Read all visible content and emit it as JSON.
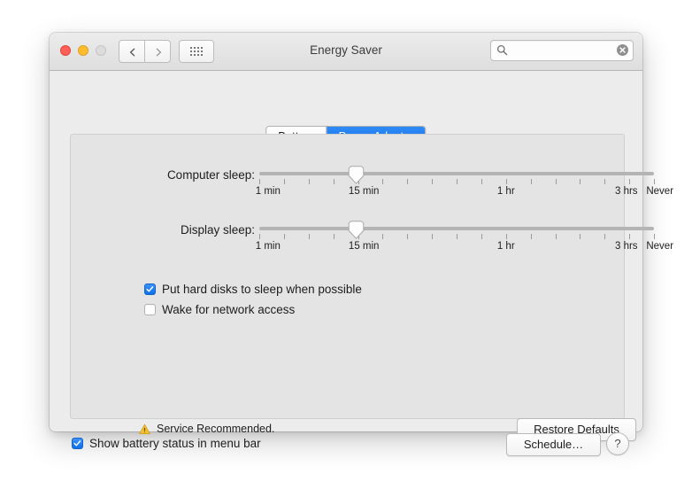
{
  "window": {
    "title": "Energy Saver",
    "traffic_lights": [
      "close",
      "minimize",
      "zoom"
    ],
    "nav": {
      "back": "back-arrow",
      "forward": "forward-arrow",
      "grid": "show-all-grid"
    },
    "search": {
      "value": "",
      "placeholder": "",
      "icon": "search-icon",
      "clear_icon": "clear-icon"
    }
  },
  "tabs": {
    "items": [
      {
        "label": "Battery",
        "active": false
      },
      {
        "label": "Power Adapter",
        "active": true
      }
    ],
    "accent_color": "#0e6fe8"
  },
  "sliders": [
    {
      "name": "computer-sleep",
      "label": "Computer sleep:",
      "value_percent": 24.5,
      "tick_count": 17,
      "scale": [
        {
          "text": "1 min",
          "pos_percent": 2.2
        },
        {
          "text": "15 min",
          "pos_percent": 26.5
        },
        {
          "text": "1 hr",
          "pos_percent": 62.5
        },
        {
          "text": "3 hrs",
          "pos_percent": 93.0
        },
        {
          "text": "Never",
          "pos_percent": 101.5
        }
      ]
    },
    {
      "name": "display-sleep",
      "label": "Display sleep:",
      "value_percent": 24.5,
      "tick_count": 17,
      "scale": [
        {
          "text": "1 min",
          "pos_percent": 2.2
        },
        {
          "text": "15 min",
          "pos_percent": 26.5
        },
        {
          "text": "1 hr",
          "pos_percent": 62.5
        },
        {
          "text": "3 hrs",
          "pos_percent": 93.0
        },
        {
          "text": "Never",
          "pos_percent": 101.5
        }
      ]
    }
  ],
  "checkboxes": {
    "hard_disks": {
      "label": "Put hard disks to sleep when possible",
      "checked": true
    },
    "wake_network": {
      "label": "Wake for network access",
      "checked": false
    },
    "battery_status": {
      "label": "Show battery status in menu bar",
      "checked": true
    }
  },
  "status": {
    "icon": "warning-triangle-icon",
    "text": "Service Recommended.",
    "icon_color": "#f2c033"
  },
  "buttons": {
    "restore_defaults": "Restore Defaults",
    "schedule": "Schedule…",
    "help": "?"
  }
}
